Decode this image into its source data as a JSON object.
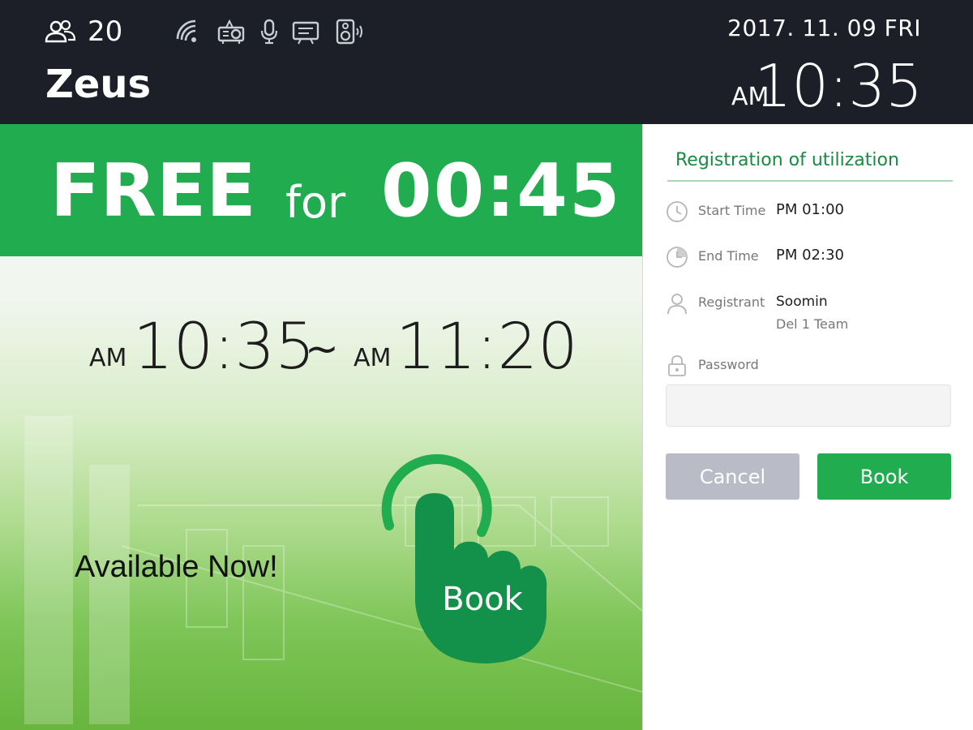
{
  "header": {
    "capacity": "20",
    "room_name": "Zeus",
    "date": "2017. 11. 09  FRI",
    "clock_ampm": "AM",
    "clock_time": "10:35",
    "icons": [
      "capacity-icon",
      "wifi-icon",
      "projector-icon",
      "microphone-icon",
      "display-board-icon",
      "speaker-icon"
    ]
  },
  "status": {
    "state": "FREE",
    "for": "for",
    "duration": "00:45"
  },
  "range": {
    "start_ampm": "AM",
    "start_time": "10:35",
    "separator": "~",
    "end_ampm": "AM",
    "end_time": "11:20"
  },
  "available_text": "Available Now!",
  "book_hand_label": "Book",
  "panel": {
    "title": "Registration of utilization",
    "start_label": "Start Time",
    "start_value": "PM 01:00",
    "end_label": "End Time",
    "end_value": "PM 02:30",
    "registrant_label": "Registrant",
    "registrant_name": "Soomin",
    "registrant_team": "Del 1 Team",
    "password_label": "Password",
    "password_value": "",
    "cancel_label": "Cancel",
    "book_label": "Book"
  },
  "colors": {
    "header_bg": "#1c1f27",
    "accent_green": "#21ac4f",
    "cancel_gray": "#b9bcc6"
  }
}
